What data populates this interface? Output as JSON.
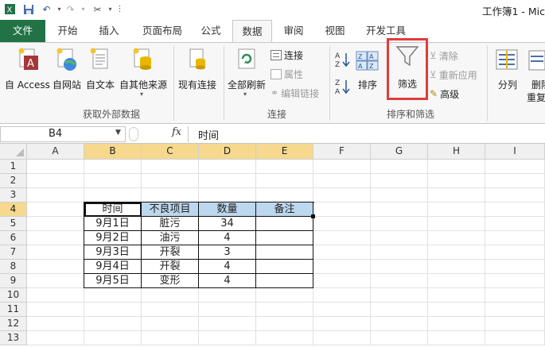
{
  "titlebar": {
    "window_title": "工作簿1 - Mic",
    "quick_access": [
      "save-icon",
      "undo-icon",
      "redo-icon",
      "tools-icon",
      "customize-icon"
    ]
  },
  "tabs": [
    "文件",
    "开始",
    "插入",
    "页面布局",
    "公式",
    "数据",
    "审阅",
    "视图",
    "开发工具"
  ],
  "ribbon": {
    "get_external": {
      "buttons": [
        "自 Access",
        "自网站",
        "自文本",
        "自其他来源"
      ],
      "existing": "现有连接",
      "group_label": "获取外部数据"
    },
    "connections": {
      "refresh_all": "全部刷新",
      "items": [
        "连接",
        "属性",
        "编辑链接"
      ],
      "group_label": "连接"
    },
    "sort_filter": {
      "sort": "排序",
      "filter": "筛选",
      "clear": "清除",
      "reapply": "重新应用",
      "advanced": "高级",
      "group_label": "排序和筛选"
    },
    "data_tools": {
      "split": "分列",
      "remove": "删除",
      "remove2": "重复"
    }
  },
  "formula": {
    "name_box": "B4",
    "fx": "fx",
    "content": "时间"
  },
  "grid": {
    "columns": [
      "A",
      "B",
      "C",
      "D",
      "E",
      "F",
      "G",
      "H",
      "I"
    ],
    "rows": [
      "1",
      "2",
      "3",
      "4",
      "5",
      "6",
      "7",
      "8",
      "9",
      "10",
      "11",
      "12",
      "13"
    ],
    "table": {
      "headers": [
        "时间",
        "不良项目",
        "数量",
        "备注"
      ],
      "rows": [
        [
          "9月1日",
          "脏污",
          "34",
          ""
        ],
        [
          "9月2日",
          "油污",
          "4",
          ""
        ],
        [
          "9月3日",
          "开裂",
          "3",
          ""
        ],
        [
          "9月4日",
          "开裂",
          "4",
          ""
        ],
        [
          "9月5日",
          "变形",
          "4",
          ""
        ]
      ]
    }
  },
  "colors": {
    "file_tab": "#217346",
    "highlight_box": "#e03c3c",
    "header_fill": "#bcd7ee",
    "selected_header": "#f6d88e"
  }
}
